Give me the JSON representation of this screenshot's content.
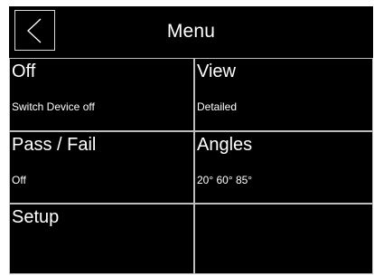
{
  "header": {
    "title": "Menu",
    "back_icon": "chevron-left-icon"
  },
  "tiles": [
    {
      "title": "Off",
      "subtitle": "Switch Device off"
    },
    {
      "title": "View",
      "subtitle": "Detailed"
    },
    {
      "title": "Pass / Fail",
      "subtitle": "Off"
    },
    {
      "title": "Angles",
      "subtitle": "20° 60° 85°"
    },
    {
      "title": "Setup",
      "subtitle": ""
    },
    {
      "title": "",
      "subtitle": ""
    }
  ],
  "colors": {
    "background": "#000000",
    "text": "#ffffff",
    "border": "#bdbdbd"
  }
}
